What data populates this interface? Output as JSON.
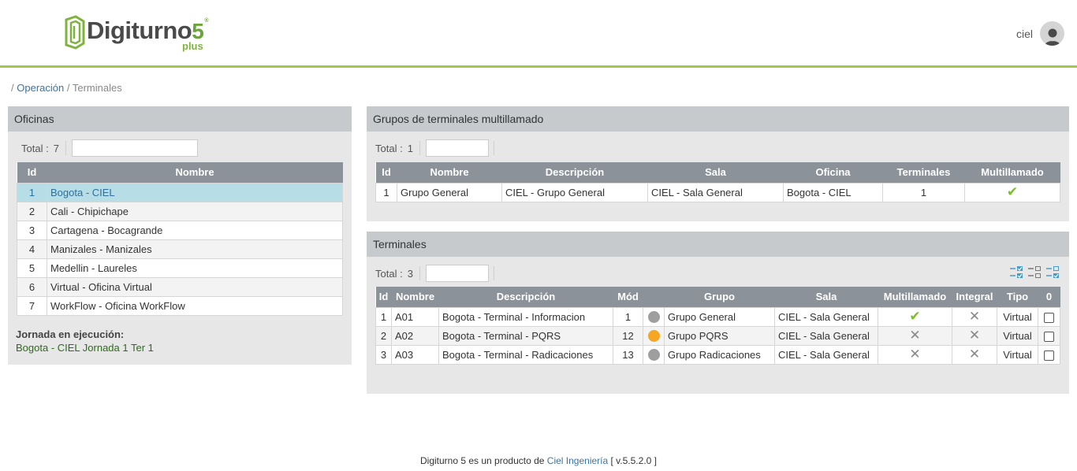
{
  "header": {
    "logo": {
      "word": "Digiturno",
      "version": "5",
      "reg": "®",
      "sub": "plus"
    },
    "user": {
      "name": "ciel"
    }
  },
  "breadcrumb": {
    "root": "/",
    "link": "Operación",
    "sep": "/",
    "current": "Terminales"
  },
  "oficinas": {
    "title": "Oficinas",
    "total_label": "Total :",
    "total_value": "7",
    "filter_value": "",
    "columns": [
      "Id",
      "Nombre"
    ],
    "rows": [
      {
        "id": "1",
        "nombre": "Bogota - CIEL"
      },
      {
        "id": "2",
        "nombre": "Cali - Chipichape"
      },
      {
        "id": "3",
        "nombre": "Cartagena - Bocagrande"
      },
      {
        "id": "4",
        "nombre": "Manizales - Manizales"
      },
      {
        "id": "5",
        "nombre": "Medellin - Laureles"
      },
      {
        "id": "6",
        "nombre": "Virtual - Oficina Virtual"
      },
      {
        "id": "7",
        "nombre": "WorkFlow - Oficina WorkFlow"
      }
    ],
    "selected_index": 0,
    "jornada_label": "Jornada en ejecución:",
    "jornada_value": "Bogota - CIEL Jornada 1 Ter 1"
  },
  "grupos": {
    "title": "Grupos de terminales multillamado",
    "total_label": "Total :",
    "total_value": "1",
    "filter_value": "",
    "columns": [
      "Id",
      "Nombre",
      "Descripción",
      "Sala",
      "Oficina",
      "Terminales",
      "Multillamado"
    ],
    "rows": [
      {
        "id": "1",
        "nombre": "Grupo General",
        "descripcion": "CIEL - Grupo General",
        "sala": "CIEL - Sala General",
        "oficina": "Bogota - CIEL",
        "terminales": "1",
        "multillamado": "check"
      }
    ]
  },
  "terminales": {
    "title": "Terminales",
    "total_label": "Total :",
    "total_value": "3",
    "filter_value": "",
    "columns": [
      "Id",
      "Nombre",
      "Descripción",
      "Mód",
      "",
      "Grupo",
      "Sala",
      "Multillamado",
      "Integral",
      "Tipo",
      "0"
    ],
    "rows": [
      {
        "id": "1",
        "nombre": "A01",
        "descripcion": "Bogota - Terminal - Informacion",
        "mod": "1",
        "status_color": "#9e9e9e",
        "grupo": "Grupo General",
        "sala": "CIEL - Sala General",
        "multillamado": "check",
        "integral": "cross",
        "tipo": "Virtual"
      },
      {
        "id": "2",
        "nombre": "A02",
        "descripcion": "Bogota - Terminal - PQRS",
        "mod": "12",
        "status_color": "#f5a623",
        "grupo": "Grupo PQRS",
        "sala": "CIEL - Sala General",
        "multillamado": "cross",
        "integral": "cross",
        "tipo": "Virtual"
      },
      {
        "id": "3",
        "nombre": "A03",
        "descripcion": "Bogota - Terminal - Radicaciones",
        "mod": "13",
        "status_color": "#9e9e9e",
        "grupo": "Grupo Radicaciones",
        "sala": "CIEL - Sala General",
        "multillamado": "cross",
        "integral": "cross",
        "tipo": "Virtual"
      }
    ],
    "toolbar_icons": [
      "select-all-icon",
      "deselect-all-icon",
      "invert-selection-icon"
    ]
  },
  "footer": {
    "prefix": "Digiturno 5 es un producto de",
    "link": "Ciel Ingeniería",
    "version": "[ v.5.5.2.0 ]"
  },
  "colors": {
    "accent": "#a2c74a",
    "panel_header": "#c6cacc",
    "table_header": "#8b9299",
    "selected_row": "#b7dde6",
    "link": "#3a75a6"
  }
}
